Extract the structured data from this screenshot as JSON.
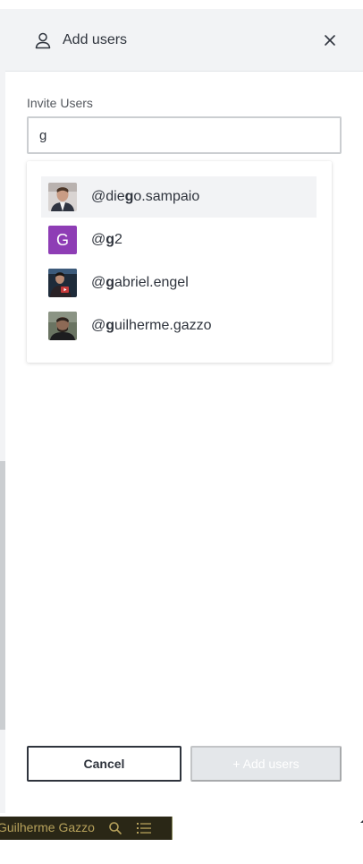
{
  "panel": {
    "title": "Add users",
    "header_icon": "user-icon",
    "close_icon": "close-icon"
  },
  "invite": {
    "label": "Invite Users",
    "value": "g",
    "placeholder": ""
  },
  "suggestions": [
    {
      "prefix": "@",
      "pre": "die",
      "match": "g",
      "post": "o.sampaio",
      "avatar": "photo",
      "active": true
    },
    {
      "prefix": "@",
      "pre": "",
      "match": "g",
      "post": "2",
      "avatar": "letter",
      "avatar_letter": "G",
      "avatar_color": "#8e3db5",
      "active": false
    },
    {
      "prefix": "@",
      "pre": "",
      "match": "g",
      "post": "abriel.engel",
      "avatar": "photo",
      "active": false
    },
    {
      "prefix": "@",
      "pre": "",
      "match": "g",
      "post": "uilherme.gazzo",
      "avatar": "photo",
      "active": false
    }
  ],
  "actions": {
    "cancel_label": "Cancel",
    "add_label": "+ Add users"
  },
  "bottom_bar": {
    "name": "Guilherme Gazzo",
    "search_icon": "search-icon",
    "list_icon": "list-icon"
  },
  "colors": {
    "header_bg": "#f2f3f5",
    "text": "#2f343d",
    "disabled_button": "#e4e7ea",
    "bottom_bar_bg": "#2a2716",
    "bottom_bar_text": "#b6a15b"
  }
}
